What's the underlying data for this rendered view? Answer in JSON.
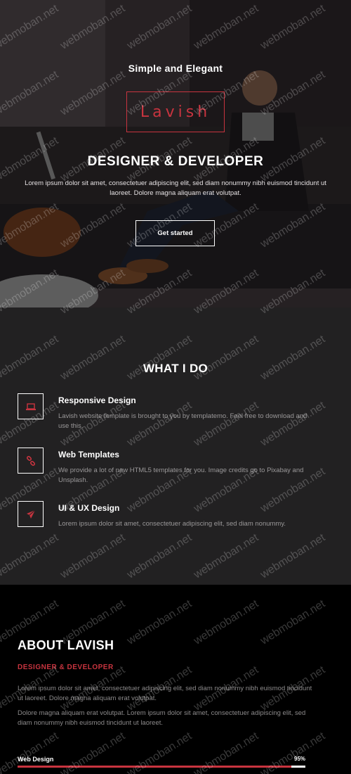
{
  "hero": {
    "tagline": "Simple and Elegant",
    "brand": "Lavish",
    "heading": "DESIGNER & DEVELOPER",
    "text": "Lorem ipsum dolor sit amet, consectetuer adipiscing elit, sed diam nonummy nibh euismod tincidunt ut laoreet. Dolore magna aliquam erat volutpat.",
    "cta_label": "Get started"
  },
  "services": {
    "title": "WHAT I DO",
    "items": [
      {
        "icon": "laptop-icon",
        "title": "Responsive Design",
        "desc": "Lavish website template is brought to you by templatemo. Feel free to download and use this."
      },
      {
        "icon": "link-icon",
        "title": "Web Templates",
        "desc": "We provide a lot of new HTML5 templates for you. Image credits go to Pixabay and Unsplash."
      },
      {
        "icon": "paper-plane-icon",
        "title": "UI & UX Design",
        "desc": "Lorem ipsum dolor sit amet, consectetuer adipiscing elit, sed diam nonummy."
      }
    ]
  },
  "about": {
    "title": "ABOUT LAVISH",
    "subtitle": "DESIGNER & DEVELOPER",
    "paragraphs": [
      "Lorem ipsum dolor sit amet, consectetuer adipiscing elit, sed diam nonummy nibh euismod tincidunt ut laoreet. Dolore magna aliquam erat volutpat.",
      "Dolore magna aliquam erat volutpat. Lorem ipsum dolor sit amet, consectetuer adipiscing elit, sed diam nonummy nibh euismod tincidunt ut laoreet."
    ],
    "skill": {
      "label": "Web Design",
      "percent_label": "95%",
      "percent": 95
    }
  },
  "watermark": "webmoban.net",
  "colors": {
    "accent": "#c8343f",
    "services_bg": "#222122",
    "about_bg": "#000000"
  }
}
